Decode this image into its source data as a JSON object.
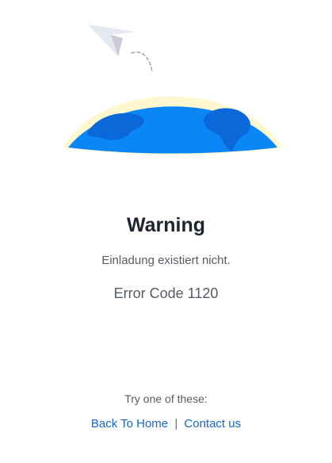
{
  "error_page": {
    "title": "Warning",
    "message": "Einladung existiert nicht.",
    "error_code": "Error Code 1120",
    "suggestion": "Try one of these:",
    "links": {
      "home": "Back To Home",
      "separator": "|",
      "contact": "Contact us"
    }
  },
  "illustration": {
    "icons": [
      "paper-plane-icon",
      "globe-icon"
    ],
    "colors": {
      "globe": "#0a86f6",
      "continent": "#0b68d8",
      "glow": "#fff7cf",
      "plane": "#e6e8f0",
      "plane_fold": "#c8cad6",
      "trail": "#9aa0aa"
    }
  },
  "colors": {
    "title": "#1f2430",
    "text": "#555b66",
    "link": "#1a66c4"
  }
}
